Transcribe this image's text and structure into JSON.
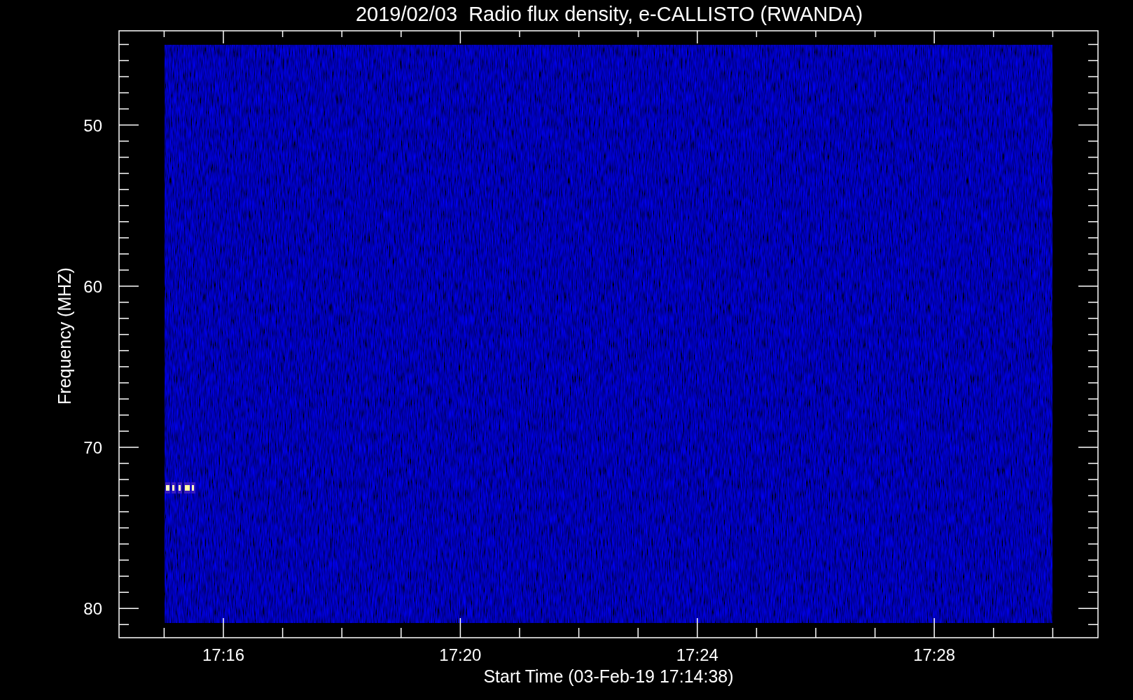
{
  "title": "2019/02/03  Radio flux density, e-CALLISTO (RWANDA)",
  "ylabel": "Frequency (MHZ)",
  "xlabel": "Start Time (03-Feb-19 17:14:38)",
  "yticks": [
    "50",
    "60",
    "70",
    "80"
  ],
  "xticks": [
    "17:16",
    "17:20",
    "17:24",
    "17:28"
  ]
}
